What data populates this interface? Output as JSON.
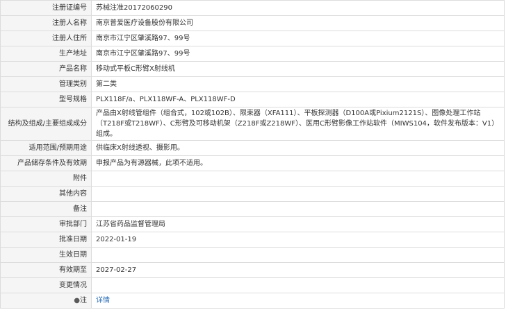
{
  "rows": [
    {
      "label": "注册证编号",
      "value": "苏械注准20172060290"
    },
    {
      "label": "注册人名称",
      "value": "南京普爱医疗设备股份有限公司"
    },
    {
      "label": "注册人住所",
      "value": "南京市江宁区肇溪路97、99号"
    },
    {
      "label": "生产地址",
      "value": "南京市江宁区肇溪路97、99号"
    },
    {
      "label": "产品名称",
      "value": "移动式平板C形臂X射线机"
    },
    {
      "label": "管理类别",
      "value": "第二类"
    },
    {
      "label": "型号规格",
      "value": "PLX118F/a、PLX118WF-A、PLX118WF-D"
    },
    {
      "label": "结构及组成/主要组成成分",
      "value": "产品由X射线管组件（组合式，102或102B）、限束器（XFA111）、平板探测器（D100A或Pixium2121S）、图像处理工作站（T218F或T218WF）、C形臂及可移动机架（Z218F或Z218WF）、医用C形臂影像工作站软件（MIWS104，软件发布版本：V1）组成。"
    },
    {
      "label": "适用范围/预期用途",
      "value": "供临床X射线透视、摄影用。"
    },
    {
      "label": "产品储存条件及有效期",
      "value": "申报产品为有源器械，此项不适用。"
    },
    {
      "label": "附件",
      "value": ""
    },
    {
      "label": "其他内容",
      "value": ""
    },
    {
      "label": "备注",
      "value": ""
    },
    {
      "label": "审批部门",
      "value": "江苏省药品监督管理局"
    },
    {
      "label": "批准日期",
      "value": "2022-01-19"
    },
    {
      "label": "生效日期",
      "value": ""
    },
    {
      "label": "有效期至",
      "value": "2027-02-27"
    },
    {
      "label": "变更情况",
      "value": ""
    }
  ],
  "note": {
    "label": "注",
    "icon": "pin-icon",
    "link_text": "详情"
  }
}
